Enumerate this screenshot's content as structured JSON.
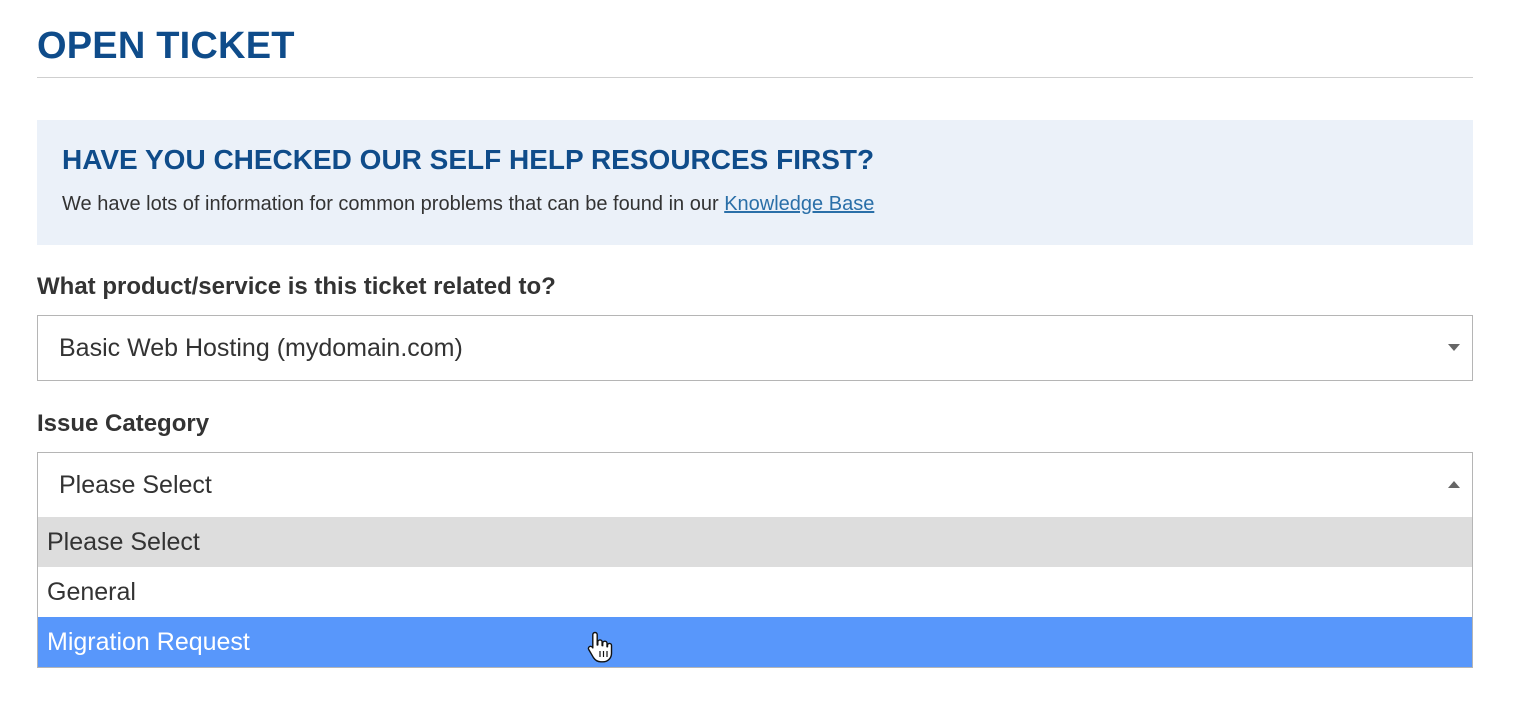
{
  "header": {
    "title": "OPEN TICKET"
  },
  "help": {
    "heading": "HAVE YOU CHECKED OUR SELF HELP RESOURCES FIRST?",
    "text": "We have lots of information for common problems that can be found in our ",
    "link_label": "Knowledge Base"
  },
  "product_field": {
    "label": "What product/service is this ticket related to?",
    "value": "Basic Web Hosting (mydomain.com)"
  },
  "category_field": {
    "label": "Issue Category",
    "value": "Please Select",
    "options": [
      "Please Select",
      "General",
      "Migration Request"
    ],
    "selected_option": "Please Select",
    "hovered_option": "Migration Request"
  },
  "colors": {
    "brand_blue": "#0f4c8a",
    "help_bg": "#ebf1f9",
    "link": "#2a6fa8",
    "hover_highlight": "#5897fb",
    "selected_bg": "#dddddd"
  },
  "icons": {
    "product_caret": "chevron-down-icon",
    "category_caret": "chevron-up-icon",
    "cursor": "hand-pointer-icon"
  }
}
